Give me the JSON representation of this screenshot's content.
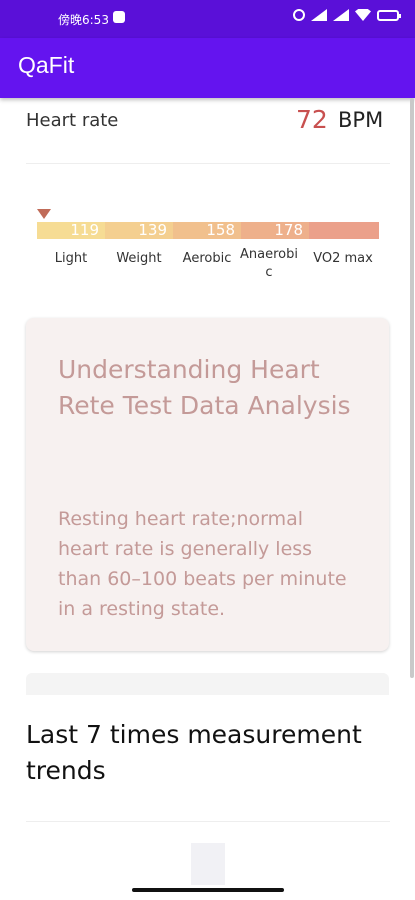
{
  "status_bar": {
    "time": "傍晚6:53",
    "icons": [
      "notification-badge-icon",
      "alarm-icon",
      "signal-icon",
      "wifi-icon",
      "battery-icon"
    ]
  },
  "app_bar": {
    "title": "QaFit",
    "color": "#6414ef"
  },
  "heart_rate": {
    "label": "Heart rate",
    "value": "72",
    "unit": "BPM",
    "value_color": "#c8504f"
  },
  "zones": {
    "thresholds": [
      "119",
      "139",
      "158",
      "178"
    ],
    "labels": [
      "Light",
      "Weight",
      "Aerobic",
      "Anaerobi\nc",
      "VO2 max"
    ],
    "colors": [
      "#f6dc94",
      "#f4cf90",
      "#f1c08d",
      "#eeb08b",
      "#eba08a"
    ]
  },
  "info_card": {
    "title": "Understanding Heart Rete Test Data Analysis",
    "body": "Resting heart rate;normal heart rate is generally less than 60–100 beats per minute in a resting state."
  },
  "trends": {
    "title": "Last 7 times measurement trends"
  }
}
